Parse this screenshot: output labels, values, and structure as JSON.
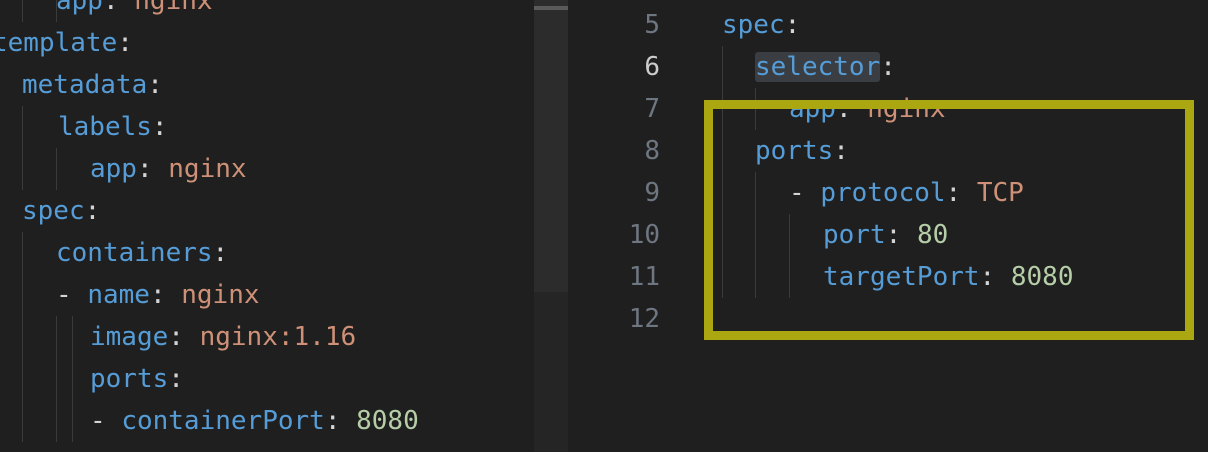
{
  "left_editor": {
    "lines": [
      {
        "key": "app",
        "sep": ": ",
        "val": "nginx",
        "valType": "str"
      },
      {
        "key": "template",
        "sep": ":",
        "val": "",
        "valType": ""
      },
      {
        "key": "metadata",
        "sep": ":",
        "val": "",
        "valType": ""
      },
      {
        "key": "labels",
        "sep": ":",
        "val": "",
        "valType": ""
      },
      {
        "key": "app",
        "sep": ": ",
        "val": "nginx",
        "valType": "str"
      },
      {
        "key": "spec",
        "sep": ":",
        "val": "",
        "valType": ""
      },
      {
        "key": "containers",
        "sep": ":",
        "val": "",
        "valType": ""
      },
      {
        "dash": "- ",
        "key": "name",
        "sep": ": ",
        "val": "nginx",
        "valType": "str"
      },
      {
        "key": "image",
        "sep": ": ",
        "val": "nginx:1.16",
        "valType": "str"
      },
      {
        "key": "ports",
        "sep": ":",
        "val": "",
        "valType": ""
      },
      {
        "dash": "- ",
        "key": "containerPort",
        "sep": ": ",
        "val": "8080",
        "valType": "num"
      }
    ]
  },
  "right_editor": {
    "active_line": "6",
    "lines": [
      {
        "num": "5",
        "key": "spec",
        "sep": ":",
        "val": "",
        "valType": ""
      },
      {
        "num": "6",
        "key": "selector",
        "sep": ":",
        "val": "",
        "valType": "",
        "highlight": true
      },
      {
        "num": "7",
        "key": "app",
        "sep": ": ",
        "val": "nginx",
        "valType": "str"
      },
      {
        "num": "8",
        "key": "ports",
        "sep": ":",
        "val": "",
        "valType": ""
      },
      {
        "num": "9",
        "dash": "- ",
        "key": "protocol",
        "sep": ": ",
        "val": "TCP",
        "valType": "str"
      },
      {
        "num": "10",
        "key": "port",
        "sep": ": ",
        "val": "80",
        "valType": "num"
      },
      {
        "num": "11",
        "key": "targetPort",
        "sep": ": ",
        "val": "8080",
        "valType": "num"
      },
      {
        "num": "12",
        "key": "",
        "sep": "",
        "val": "",
        "valType": ""
      }
    ]
  },
  "colors": {
    "key": "#569cd6",
    "string": "#ce9178",
    "number": "#b5cea8",
    "highlight_box": "#aaa711",
    "background": "#1f1f1f"
  }
}
